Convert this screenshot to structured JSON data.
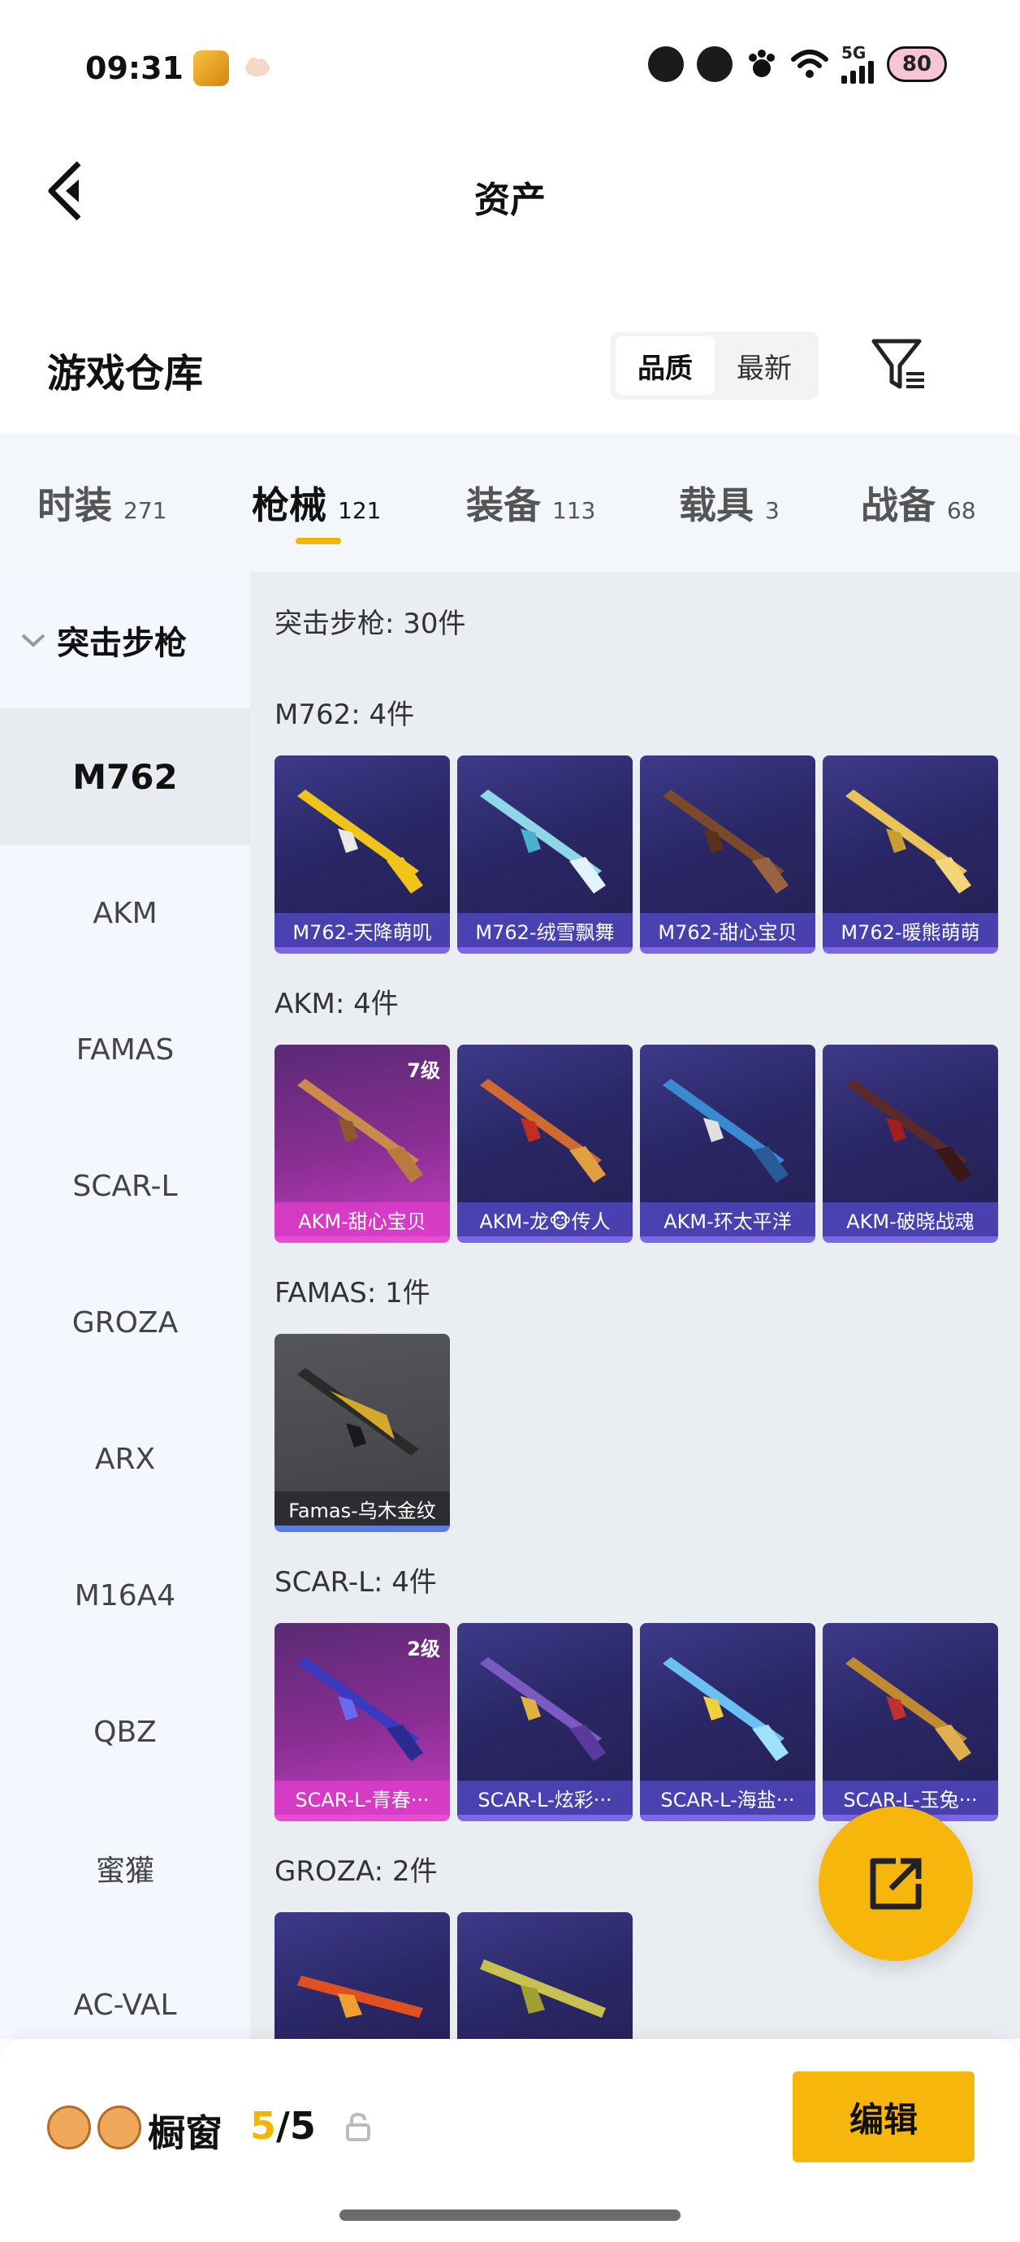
{
  "status_bar": {
    "time": "09:31",
    "network": "5G",
    "battery": "80",
    "signal_level": 4
  },
  "header": {
    "title": "资产"
  },
  "warehouse": {
    "title": "游戏仓库",
    "sort_options": [
      "品质",
      "最新"
    ],
    "sort_selected": "品质"
  },
  "tabs": [
    {
      "label": "时装",
      "count": "271"
    },
    {
      "label": "枪械",
      "count": "121"
    },
    {
      "label": "装备",
      "count": "113"
    },
    {
      "label": "载具",
      "count": "3"
    },
    {
      "label": "战备",
      "count": "68"
    }
  ],
  "active_tab": "枪械",
  "sidebar": {
    "group_label": "突击步枪",
    "items": [
      "M762",
      "AKM",
      "FAMAS",
      "SCAR-L",
      "GROZA",
      "ARX",
      "M16A4",
      "QBZ",
      "蜜獾",
      "AC-VAL"
    ],
    "selected": "M762"
  },
  "main": {
    "category_summary": "突击步枪: 30件",
    "sections": [
      {
        "title": "M762: 4件",
        "items": [
          {
            "name": "M762-天降萌叽",
            "tier": "purple",
            "level": ""
          },
          {
            "name": "M762-绒雪飘舞",
            "tier": "purple",
            "level": ""
          },
          {
            "name": "M762-甜心宝贝",
            "tier": "purple",
            "level": ""
          },
          {
            "name": "M762-暖熊萌萌",
            "tier": "purple",
            "level": ""
          }
        ]
      },
      {
        "title": "AKM: 4件",
        "items": [
          {
            "name": "AKM-甜心宝贝",
            "tier": "pink",
            "level": "7级"
          },
          {
            "name": "AKM-龙🐵传人",
            "tier": "purple",
            "level": ""
          },
          {
            "name": "AKM-环太平洋",
            "tier": "purple",
            "level": ""
          },
          {
            "name": "AKM-破晓战魂",
            "tier": "purple",
            "level": ""
          }
        ]
      },
      {
        "title": "FAMAS: 1件",
        "items": [
          {
            "name": "Famas-乌木金纹",
            "tier": "grey",
            "level": ""
          }
        ]
      },
      {
        "title": "SCAR-L: 4件",
        "items": [
          {
            "name": "SCAR-L-青春···",
            "tier": "pink",
            "level": "2级"
          },
          {
            "name": "SCAR-L-炫彩···",
            "tier": "purple",
            "level": ""
          },
          {
            "name": "SCAR-L-海盐···",
            "tier": "purple",
            "level": ""
          },
          {
            "name": "SCAR-L-玉兔···",
            "tier": "purple",
            "level": ""
          }
        ]
      },
      {
        "title": "GROZA: 2件",
        "items": [
          {
            "name": "",
            "tier": "purple",
            "level": ""
          },
          {
            "name": "",
            "tier": "purple",
            "level": ""
          }
        ]
      }
    ]
  },
  "bottom_bar": {
    "title": "橱窗",
    "count_current": "5",
    "count_separator": "/",
    "count_total": "5",
    "edit_label": "编辑"
  },
  "colors": {
    "accent": "#f7b60c",
    "tab_bg": "#f3f6fb",
    "grid_bg": "#eaedf2",
    "purple_card": "#2a2766",
    "pink_card": "#8a2e93",
    "grey_card": "#404146"
  }
}
